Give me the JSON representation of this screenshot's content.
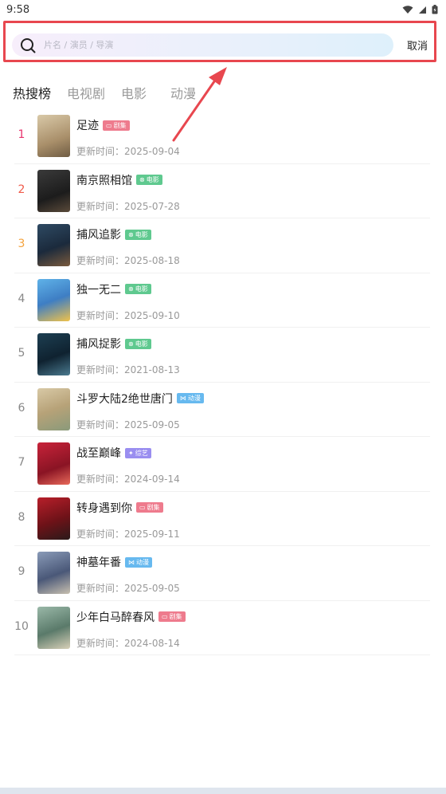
{
  "status_bar": {
    "time": "9:58"
  },
  "search": {
    "placeholder": "片名 / 演员 / 导演",
    "cancel_label": "取消"
  },
  "tabs": [
    {
      "label": "热搜榜",
      "active": true
    },
    {
      "label": "电视剧",
      "active": false
    },
    {
      "label": "电影",
      "active": false
    },
    {
      "label": "动漫",
      "active": false
    }
  ],
  "update_prefix": "更新时间：",
  "items": [
    {
      "rank": "1",
      "title": "足迹",
      "badge": "剧集",
      "date": "2025-09-04"
    },
    {
      "rank": "2",
      "title": "南京照相馆",
      "badge": "电影",
      "date": "2025-07-28"
    },
    {
      "rank": "3",
      "title": "捕风追影",
      "badge": "电影",
      "date": "2025-08-18"
    },
    {
      "rank": "4",
      "title": "独一无二",
      "badge": "电影",
      "date": "2025-09-10"
    },
    {
      "rank": "5",
      "title": "捕风捉影",
      "badge": "电影",
      "date": "2021-08-13"
    },
    {
      "rank": "6",
      "title": "斗罗大陆2绝世唐门",
      "badge": "动漫",
      "date": "2025-09-05"
    },
    {
      "rank": "7",
      "title": "战至巅峰",
      "badge": "综艺",
      "date": "2024-09-14"
    },
    {
      "rank": "8",
      "title": "转身遇到你",
      "badge": "剧集",
      "date": "2025-09-11"
    },
    {
      "rank": "9",
      "title": "神墓年番",
      "badge": "动漫",
      "date": "2025-09-05"
    },
    {
      "rank": "10",
      "title": "少年白马醉春风",
      "badge": "剧集",
      "date": "2024-08-14"
    }
  ],
  "colors": {
    "rank1": "#e8336d",
    "rank2": "#f05a4a",
    "rank3": "#f4a23b",
    "rank_other": "#888888",
    "badge_tv": "#ee7b8d",
    "badge_movie": "#5fc98f",
    "badge_anime": "#67b9ef",
    "badge_variety": "#9a8ef0",
    "highlight": "#e8474f"
  },
  "icons": {
    "search": "search-icon",
    "badge_tv": "tv-icon",
    "badge_movie": "film-reel-icon",
    "badge_anime": "bow-icon",
    "badge_variety": "star-icon"
  }
}
